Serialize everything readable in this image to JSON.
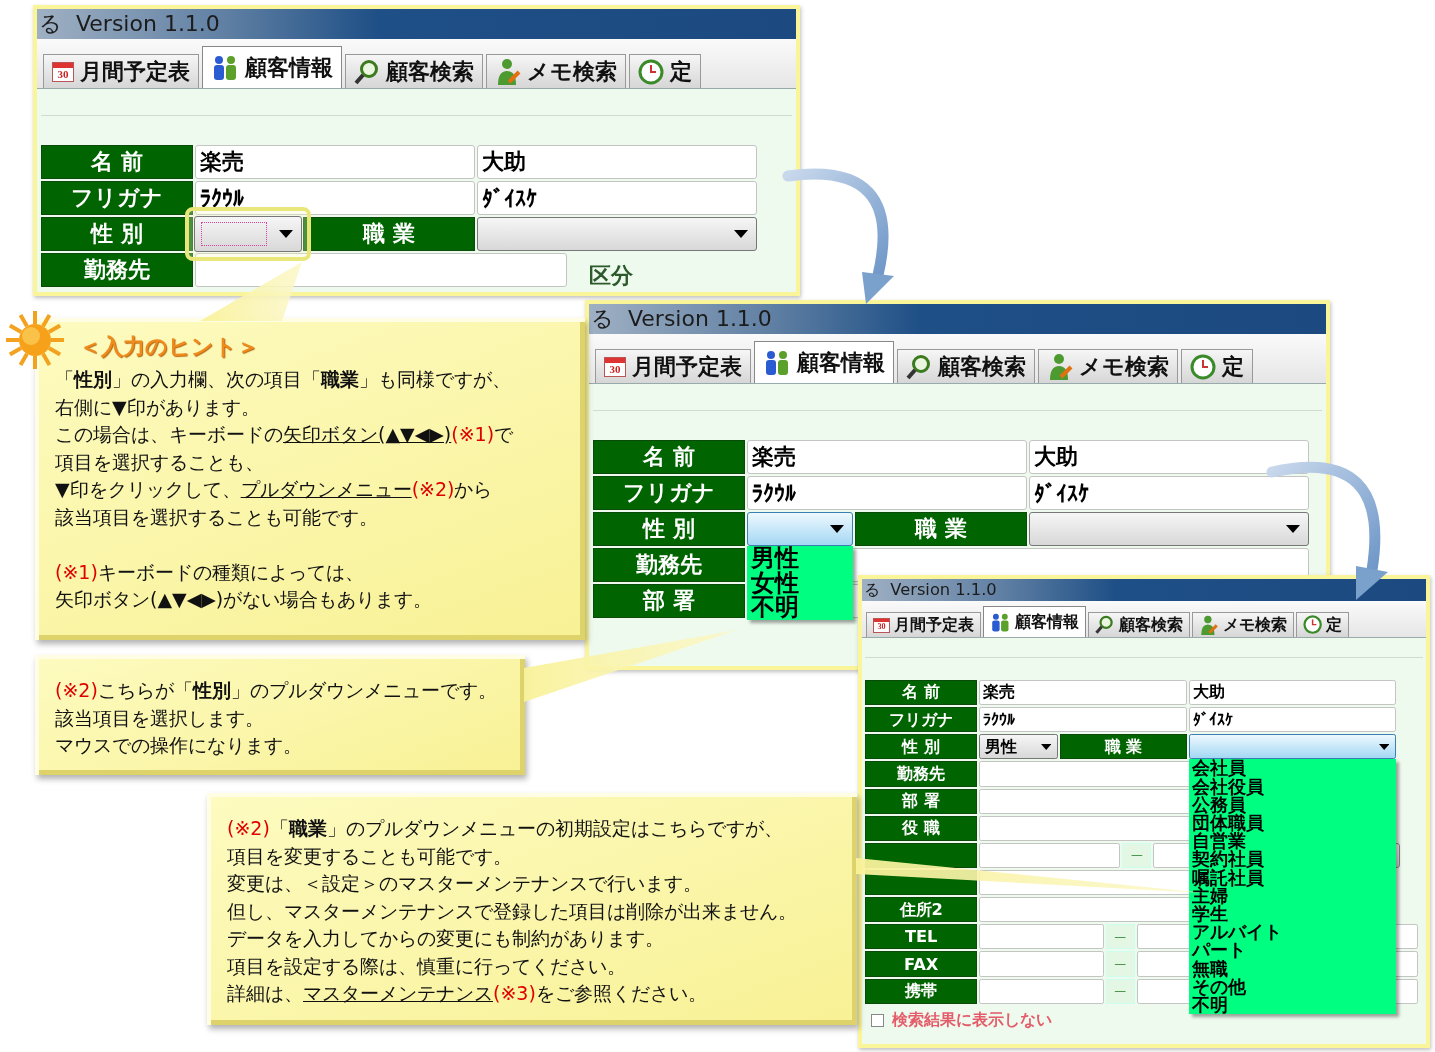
{
  "screenshots": [
    {
      "title": "る  Version 1.1.0",
      "tabs": [
        {
          "label": "月間予定表",
          "icon_text": "30",
          "selected": false
        },
        {
          "label": "顧客情報",
          "selected": true
        },
        {
          "label": "顧客検索",
          "selected": false
        },
        {
          "label": "メモ検索",
          "selected": false
        },
        {
          "label": "定",
          "selected": false
        }
      ],
      "rows": [
        {
          "kind": "pair",
          "label": "名 前",
          "values": [
            "楽売",
            "大助"
          ]
        },
        {
          "kind": "pair",
          "label": "フリガナ",
          "values": [
            "ﾗｸｳﾙ",
            "ﾀﾞｲｽｹ"
          ]
        },
        {
          "kind": "choice",
          "label": "性 別",
          "select": {
            "focused": true,
            "open": false,
            "highlight": true
          },
          "label2": "職 業",
          "select2": {
            "focused": false,
            "open": false
          }
        },
        {
          "kind": "single",
          "label": "勤務先",
          "aside": "区分"
        }
      ]
    },
    {
      "title": "る  Version 1.1.0",
      "tabs": [
        {
          "label": "月間予定表",
          "icon_text": "30",
          "selected": false
        },
        {
          "label": "顧客情報",
          "selected": true
        },
        {
          "label": "顧客検索",
          "selected": false
        },
        {
          "label": "メモ検索",
          "selected": false
        },
        {
          "label": "定",
          "selected": false
        }
      ],
      "rows": [
        {
          "kind": "pair",
          "label": "名 前",
          "values": [
            "楽売",
            "大助"
          ]
        },
        {
          "kind": "pair",
          "label": "フリガナ",
          "values": [
            "ﾗｸｳﾙ",
            "ﾀﾞｲｽｹ"
          ]
        },
        {
          "kind": "choice",
          "label": "性 別",
          "select": {
            "focused": false,
            "open": true,
            "options": [
              "男性",
              "女性",
              "不明"
            ]
          },
          "label2": "職 業",
          "select2": {
            "focused": false,
            "open": false
          }
        },
        {
          "kind": "single",
          "label": "勤務先"
        },
        {
          "kind": "single",
          "label": "部 署"
        }
      ]
    },
    {
      "title": "る  Version 1.1.0",
      "tabs": [
        {
          "label": "月間予定表",
          "icon_text": "30",
          "selected": false
        },
        {
          "label": "顧客情報",
          "selected": true
        },
        {
          "label": "顧客検索",
          "selected": false
        },
        {
          "label": "メモ検索",
          "selected": false
        },
        {
          "label": "定",
          "selected": false
        }
      ],
      "rows": [
        {
          "kind": "pair",
          "label": "名 前",
          "values": [
            "楽売",
            "大助"
          ]
        },
        {
          "kind": "pair",
          "label": "フリガナ",
          "values": [
            "ﾗｸｳﾙ",
            "ﾀﾞｲｽｹ"
          ]
        },
        {
          "kind": "choice",
          "label": "性 別",
          "select": {
            "focused": false,
            "open": false,
            "value": "男性"
          },
          "label2": "職 業",
          "select2": {
            "focused": false,
            "open": true,
            "options": [
              "会社員",
              "会社役員",
              "公務員",
              "団体職員",
              "自営業",
              "契約社員",
              "嘱託社員",
              "主婦",
              "学生",
              "アルバイト",
              "パート",
              "無職",
              "その他",
              "不明"
            ]
          }
        },
        {
          "kind": "single",
          "label": "勤務先"
        },
        {
          "kind": "single",
          "label": "部 署"
        },
        {
          "kind": "single",
          "label": "役 職"
        },
        {
          "kind": "postal",
          "separator": "—"
        },
        {
          "kind": "single"
        },
        {
          "kind": "single",
          "label": "住所2"
        },
        {
          "kind": "phone",
          "label": "TEL",
          "separator": "—"
        },
        {
          "kind": "phone",
          "label": "FAX",
          "separator": "—"
        },
        {
          "kind": "phone",
          "label": "携帯",
          "separator": "—"
        }
      ],
      "checkbox": {
        "label": "検索結果に表示しない",
        "checked": false
      }
    }
  ],
  "callouts": [
    {
      "heading": "＜入力のヒント＞",
      "paragraphs": [
        {
          "lines": [
            [
              {
                "kind": "text",
                "text": "「**性別**」の入力欄、次の項目「**職業**」も同様ですが、"
              }
            ],
            [
              {
                "kind": "text",
                "text": "右側に▼印があります。"
              }
            ],
            [
              {
                "kind": "text",
                "text": "この場合は、キーボードの"
              },
              {
                "kind": "link",
                "text": "矢印ボタン(▲▼◀▶)"
              },
              {
                "kind": "red",
                "text": "(※1)"
              },
              {
                "kind": "text",
                "text": "で"
              }
            ],
            [
              {
                "kind": "text",
                "text": "項目を選択することも、"
              }
            ],
            [
              {
                "kind": "text",
                "text": "▼印をクリックして、"
              },
              {
                "kind": "link",
                "text": "プルダウンメニュー"
              },
              {
                "kind": "red",
                "text": "(※2)"
              },
              {
                "kind": "text",
                "text": "から"
              }
            ],
            [
              {
                "kind": "text",
                "text": "該当項目を選択することも可能です。"
              }
            ]
          ]
        },
        {
          "lines": [
            [
              {
                "kind": "red",
                "text": "(※1)"
              },
              {
                "kind": "text",
                "text": "キーボードの種類によっては、"
              }
            ],
            [
              {
                "kind": "text",
                "text": "矢印ボタン(▲▼◀▶)がない場合もあります。"
              }
            ]
          ]
        }
      ]
    },
    {
      "paragraphs": [
        {
          "lines": [
            [
              {
                "kind": "red",
                "text": "(※2)"
              },
              {
                "kind": "text",
                "text": "こちらが「**性別**」のプルダウンメニューです。"
              }
            ],
            [
              {
                "kind": "text",
                "text": "該当項目を選択します。"
              }
            ],
            [
              {
                "kind": "text",
                "text": "マウスでの操作になります。"
              }
            ]
          ]
        }
      ]
    },
    {
      "paragraphs": [
        {
          "lines": [
            [
              {
                "kind": "red",
                "text": "(※2)"
              },
              {
                "kind": "text",
                "text": "「**職業**」のプルダウンメニューの初期設定はこちらですが、"
              }
            ],
            [
              {
                "kind": "text",
                "text": "項目を変更することも可能です。"
              }
            ],
            [
              {
                "kind": "text",
                "text": "変更は、＜設定＞のマスターメンテナンスで行います。"
              }
            ],
            [
              {
                "kind": "text",
                "text": "但し、マスターメンテナンスで登録した項目は削除が出来ません。"
              }
            ],
            [
              {
                "kind": "text",
                "text": "データを入力してからの変更にも制約があります。"
              }
            ],
            [
              {
                "kind": "text",
                "text": "項目を設定する際は、慎重に行ってください。"
              }
            ],
            [
              {
                "kind": "text",
                "text": "詳細は、"
              },
              {
                "kind": "link",
                "text": "マスターメンテナンス"
              },
              {
                "kind": "red",
                "text": "(※3)"
              },
              {
                "kind": "text",
                "text": "をご参照ください。"
              }
            ]
          ]
        }
      ]
    }
  ]
}
